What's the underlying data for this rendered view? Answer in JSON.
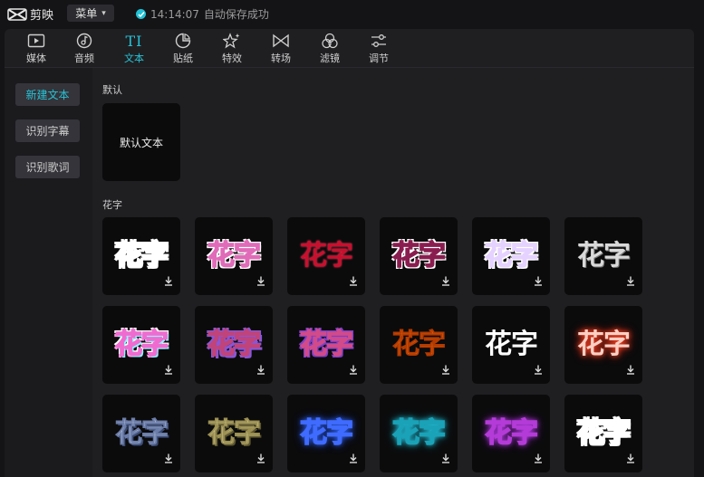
{
  "app": {
    "name": "剪映"
  },
  "topbar": {
    "menu_label": "菜单",
    "save_time": "14:14:07",
    "save_text": "自动保存成功"
  },
  "tabs": [
    {
      "label": "媒体",
      "icon": "media-icon"
    },
    {
      "label": "音频",
      "icon": "audio-icon"
    },
    {
      "label": "文本",
      "icon": "text-icon",
      "active": true
    },
    {
      "label": "贴纸",
      "icon": "sticker-icon"
    },
    {
      "label": "特效",
      "icon": "effects-icon"
    },
    {
      "label": "转场",
      "icon": "transition-icon"
    },
    {
      "label": "滤镜",
      "icon": "filter-icon"
    },
    {
      "label": "调节",
      "icon": "adjust-icon"
    }
  ],
  "sidebar": {
    "items": [
      {
        "label": "新建文本",
        "active": true
      },
      {
        "label": "识别字幕"
      },
      {
        "label": "识别歌词"
      }
    ]
  },
  "sections": {
    "default_label": "默认",
    "default_card": "默认文本",
    "huazi_label": "花字"
  },
  "huazi_text": "花字",
  "colors": {
    "accent": "#27c2d6",
    "panel": "#1f1f22",
    "card": "#0b0b0c"
  }
}
